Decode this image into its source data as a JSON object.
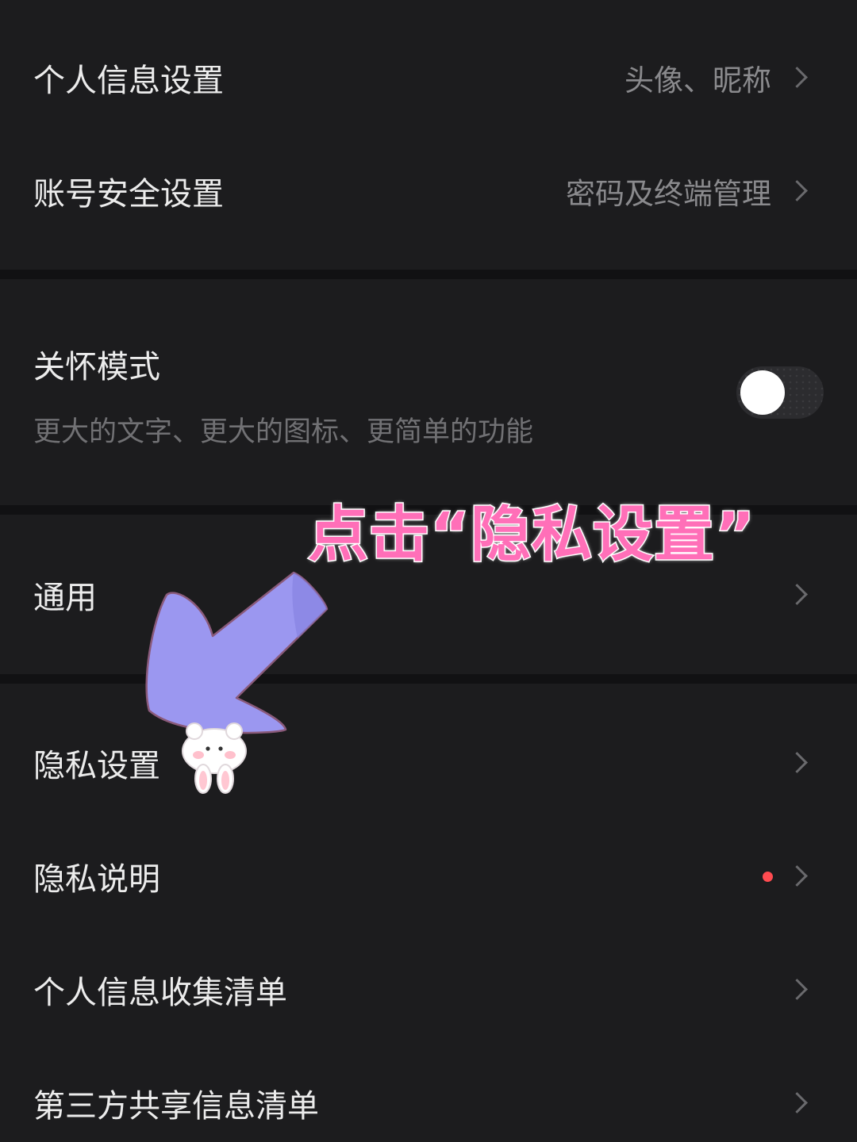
{
  "settings": {
    "personal_info": {
      "label": "个人信息设置",
      "value": "头像、昵称"
    },
    "account_security": {
      "label": "账号安全设置",
      "value": "密码及终端管理"
    },
    "care_mode": {
      "label": "关怀模式",
      "description": "更大的文字、更大的图标、更简单的功能",
      "enabled": false
    },
    "general": {
      "label": "通用"
    },
    "privacy_settings": {
      "label": "隐私设置"
    },
    "privacy_statement": {
      "label": "隐私说明",
      "has_badge": true
    },
    "personal_info_list": {
      "label": "个人信息收集清单"
    },
    "third_party_list": {
      "label": "第三方共享信息清单"
    }
  },
  "annotation": {
    "text": "点击“隐私设置”",
    "color": "#ff6fb8",
    "arrow_color": "#9b97f0"
  },
  "colors": {
    "background": "#1c1c1e",
    "separator": "#111113",
    "primary_text": "#ececec",
    "secondary_text": "#8a8a8d",
    "badge": "#ff4b50"
  }
}
